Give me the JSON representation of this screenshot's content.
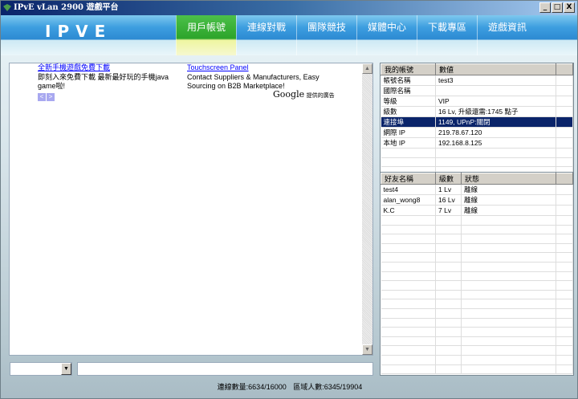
{
  "window": {
    "title": "IPvE vLan 2900 遊戲平台",
    "min": "_",
    "max": "□",
    "close": "X"
  },
  "nav": {
    "logo": "IPVE",
    "tabs": [
      "用戶帳號",
      "連線對戰",
      "團隊競技",
      "媒體中心",
      "下載專區",
      "遊戲資訊"
    ],
    "active": 0
  },
  "ads": {
    "left": {
      "link": "全新手機遊戲免費下載",
      "text": "即刻入來免費下載  最新最好玩的手機java game啦!",
      "prev": "<",
      "next": ">"
    },
    "right": {
      "link": "Touchscreen Panel",
      "text": "Contact Suppliers & Manufacturers, Easy Sourcing on B2B Marketplace!"
    },
    "google": "Google",
    "google_caption": "提供的廣告"
  },
  "account": {
    "headers": [
      "我的帳號",
      "數値"
    ],
    "rows": [
      [
        "帳號名稱",
        "test3"
      ],
      [
        "國際名稱",
        ""
      ],
      [
        "等級",
        "VIP"
      ],
      [
        "級數",
        "16 Lv, 升級還需:1745 點子"
      ],
      [
        "連接埠",
        "1149, UPnP:關閉"
      ],
      [
        "網際 IP",
        "219.78.67.120"
      ],
      [
        "本地 IP",
        "192.168.8.125"
      ]
    ],
    "selected": 4
  },
  "friends": {
    "headers": [
      "好友名稱",
      "級數",
      "狀態"
    ],
    "rows": [
      [
        "test4",
        "1 Lv",
        "離線"
      ],
      [
        "alan_wong8",
        "16 Lv",
        "離線"
      ],
      [
        "K.C",
        "7 Lv",
        "離線"
      ]
    ]
  },
  "status": {
    "connections": "連線數量:6634/16000",
    "region": "區域人數:6345/19904"
  }
}
